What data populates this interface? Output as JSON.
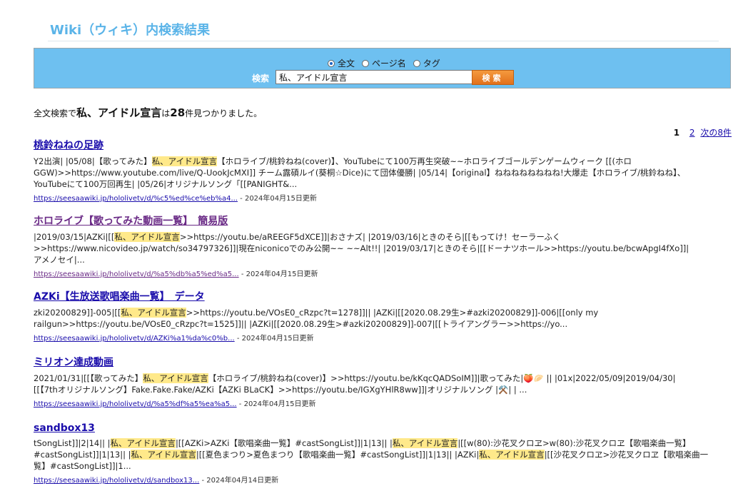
{
  "header": {
    "title": "Wiki（ウィキ）内検索結果"
  },
  "search": {
    "options": [
      "全文",
      "ページ名",
      "タグ"
    ],
    "selected": "全文",
    "label": "検索",
    "value": "私、アイドル宣言",
    "button": "検索"
  },
  "summary": {
    "prefix": "全文検索で",
    "query": "私、アイドル宣言",
    "mid": "は",
    "count": "28",
    "suffix": "件見つかりました。"
  },
  "pagination": {
    "current": "1",
    "next_page": "2",
    "next_label": "次の8件"
  },
  "results": [
    {
      "title": "桃鈴ねねの足跡",
      "lines": [
        [
          "Y2出演| |05/08|【歌ってみた】",
          "私、アイドル宣言",
          "【ホロライブ/桃鈴ねね(cover)】、YouTubeにて100万再生突破~~ホロライブゴールデンゲームウィーク [[(ホロ"
        ],
        [
          "GGW)>>https://www.youtube.com/live/Q-UookJcMXI]] チーム露碩ルイ(葵桐☆Dice)にて団体優勝| |05/14|【original】ねねねねねねねね!大爆走【ホロライブ/桃鈴ねね】、"
        ],
        [
          "YouTubeにて100万回再生| |05/26|オリジナルソング「[[PANIGHT&..."
        ]
      ],
      "url": "https://seesaawiki.jp/hololivetv/d/%c5%ed%ce%eb%a4...",
      "date": "2024年04月15日更新"
    },
    {
      "title": "ホロライブ【歌ってみた動画一覧】　簡易版",
      "lines": [
        [
          "|2019/03/15|AZKi|[[",
          "私、アイドル宣言",
          ">>https://youtu.be/aREEGF5dXCE]]|おさナズ| |2019/03/16|ときのそら|[[もってけ！セーラーふく"
        ],
        [
          ">>https://www.nicovideo.jp/watch/so34797326]]|現在niconicoでのみ公開~~ ~~Alt!!| |2019/03/17|ときのそら|[[ドーナツホール>>https://youtu.be/bcwApgI4fXo]]|"
        ],
        [
          "アメノセイ|..."
        ]
      ],
      "url": "https://seesaawiki.jp/hololivetv/d/%a5%db%a5%ed%a5...",
      "date": "2024年04月15日更新"
    },
    {
      "title": "AZKi【生放送歌唱楽曲一覧】　データ",
      "lines": [
        [
          "zki20200829]]-005|[[",
          "私、アイドル宣言",
          ">>https://youtu.be/VOsE0_cRzpc?t=1278]]|| |AZKi|[[2020.08.29生>#azki20200829]]-006|[[only my"
        ],
        [
          "railgun>>https://youtu.be/VOsE0_cRzpc?t=1525]]|| |AZKi|[[2020.08.29生>#azki20200829]]-007|[[トライアングラー>>https://yo..."
        ]
      ],
      "url": "https://seesaawiki.jp/hololivetv/d/AZKi%a1%da%c0%b...",
      "date": "2024年04月15日更新"
    },
    {
      "title": "ミリオン達成動画",
      "lines": [
        [
          "2021/01/31|[[【歌ってみた】",
          "私、アイドル宣言",
          "【ホロライブ/桃鈴ねね(cover)】>>https://youtu.be/kKqcQADSoIM]]|歌ってみた|🍑🥟 || |01x|2022/05/09|2019/04/30|"
        ],
        [
          "[[【7thオリジナルソング】Fake.Fake.Fake/AZKi【AZKi BLaCK】>>https://youtu.be/IGXgYHlR8ww]]|オリジナルソング |⚒️| | ..."
        ]
      ],
      "url": "https://seesaawiki.jp/hololivetv/d/%a5%df%a5%ea%a5...",
      "date": "2024年04月15日更新"
    },
    {
      "title": "sandbox13",
      "lines": [
        [
          "tSongList]]|2|14|| |",
          "私、アイドル宣言",
          "|[[AZKi>AZKi【歌唱楽曲一覧】#castSongList]]|1|13|| |",
          "私、アイドル宣言",
          "|[[w(80):沙花叉クロヱ>w(80):沙花叉クロヱ【歌唱楽曲一覧】"
        ],
        [
          "#castSongList]]|1|13|| |",
          "私、アイドル宣言",
          "|[[夏色まつり>夏色まつり【歌唱楽曲一覧】#castSongList]]|1|13|| |AZKi|",
          "私、アイドル宣言",
          "|[[沙花叉クロヱ>沙花叉クロヱ【歌唱楽曲一"
        ],
        [
          "覧】#castSongList]]|1..."
        ]
      ],
      "url": "https://seesaawiki.jp/hololivetv/d/sandbox13...",
      "date": "2024年04月14日更新"
    }
  ]
}
